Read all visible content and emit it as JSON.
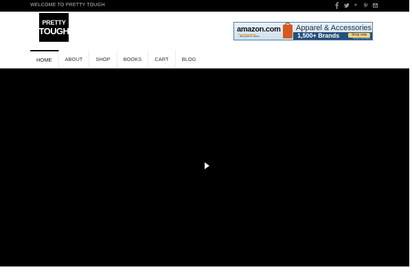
{
  "topbar": {
    "welcome_text": "WELCOME TO PRETTY TOUGH",
    "social_icons": [
      "facebook-icon",
      "twitter-icon",
      "google-plus-icon",
      "pinterest-icon",
      "email-icon"
    ]
  },
  "logo": {
    "line1": "PRETTY",
    "line2": "TOUGH"
  },
  "banner": {
    "brand": "amazon.com",
    "tagline": "and you're done.",
    "title": "Apparel & Accessories",
    "brands": "1,500+ Brands",
    "shop_now": "Shop now",
    "privacy": "Privacy Information"
  },
  "nav": {
    "items": [
      {
        "label": "HOME",
        "active": true
      },
      {
        "label": "ABOUT"
      },
      {
        "label": "SHOP"
      },
      {
        "label": "BOOKS"
      },
      {
        "label": "CART"
      },
      {
        "label": "BLOG"
      }
    ]
  },
  "video": {
    "play_icon": "play-icon"
  },
  "colors": {
    "topbar": "#000000",
    "video_bg": "#000000",
    "active_border": "#000000"
  }
}
